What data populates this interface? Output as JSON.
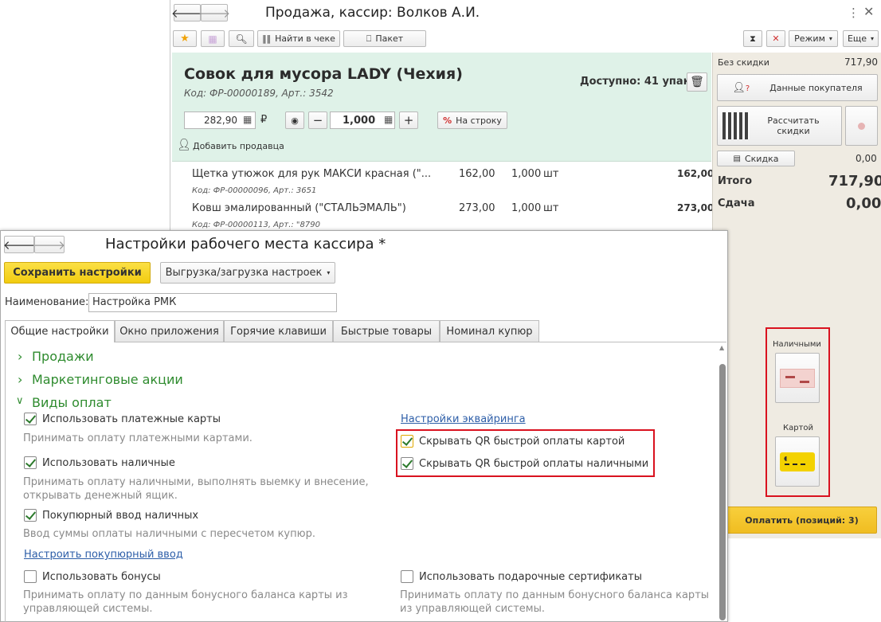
{
  "pos": {
    "title": "Продажа, кассир: Волков А.И.",
    "toolbar": {
      "find_in_receipt": "Найти в чеке",
      "package": "Пакет",
      "mode": "Режим",
      "more": "Еще"
    },
    "product": {
      "name": "Совок для мусора LADY (Чехия)",
      "code": "Код: ФР-00000189, Арт.: 3542",
      "available": "Доступно: 41 упак",
      "price": "282,90",
      "currency": "₽",
      "quantity": "1,000",
      "to_line": "На строку",
      "add_seller": "Добавить продавца"
    },
    "items": [
      {
        "name": "Щетка утюжок для рук МАКСИ красная (\"...",
        "code": "Код: ФР-00000096, Арт.: 3651",
        "price": "162,00",
        "qty": "1,000",
        "unit": "шт",
        "sum": "162,00"
      },
      {
        "name": "Ковш эмалированный (\"СТАЛЬЭМАЛЬ\")",
        "code": "Код: ФР-00000113, Арт.: \"8790",
        "price": "273,00",
        "qty": "1,000",
        "unit": "шт",
        "sum": "273,00"
      }
    ],
    "right": {
      "no_discount_label": "Без скидки",
      "no_discount_value": "717,90",
      "buyer_data": "Данные покупателя",
      "calc_discounts": "Рассчитать скидки",
      "discount": "Скидка",
      "discount_value": "0,00",
      "total_label": "Итого",
      "total_value": "717,90",
      "change_label": "Сдача",
      "change_value": "0,00",
      "cash_label": "Наличными",
      "card_label": "Картой",
      "pay_button": "Оплатить (позиций: 3)"
    }
  },
  "settings": {
    "title": "Настройки рабочего места кассира *",
    "save_button": "Сохранить настройки",
    "export_button": "Выгрузка/загрузка настроек",
    "name_label": "Наименование:",
    "name_value": "Настройка РМК",
    "tabs": [
      "Общие настройки",
      "Окно приложения",
      "Горячие клавиши",
      "Быстрые товары",
      "Номинал купюр"
    ],
    "groups": {
      "sales": "Продажи",
      "marketing": "Маркетинговые акции",
      "payment_types": "Виды оплат"
    },
    "options": {
      "use_cards": "Использовать платежные карты",
      "use_cards_desc": "Принимать оплату платежными картами.",
      "use_cash": "Использовать наличные",
      "use_cash_desc": "Принимать оплату наличными, выполнять выемку и внесение, открывать денежный ящик.",
      "bill_input": "Покупюрный ввод наличных",
      "bill_input_desc": "Ввод суммы оплаты наличными с пересчетом купюр.",
      "bill_input_link": "Настроить покупюрный ввод",
      "use_bonuses": "Использовать бонусы",
      "use_bonuses_desc": "Принимать оплату по данным бонусного баланса карты из управляющей системы.",
      "acquiring_link": "Настройки эквайринга",
      "hide_qr_card": "Скрывать QR быстрой оплаты картой",
      "hide_qr_cash": "Скрывать QR быстрой оплаты наличными",
      "use_gift_certs": "Использовать подарочные сертификаты",
      "use_gift_certs_desc": "Принимать оплату по данным бонусного баланса карты из управляющей системы."
    }
  },
  "colors": {
    "accent_green": "#2e8b2e",
    "highlight_red": "#d9121f",
    "save_yellow": "#f5d21a",
    "pay_yellow": "#f3c32c",
    "product_bg": "#dff2e8"
  }
}
